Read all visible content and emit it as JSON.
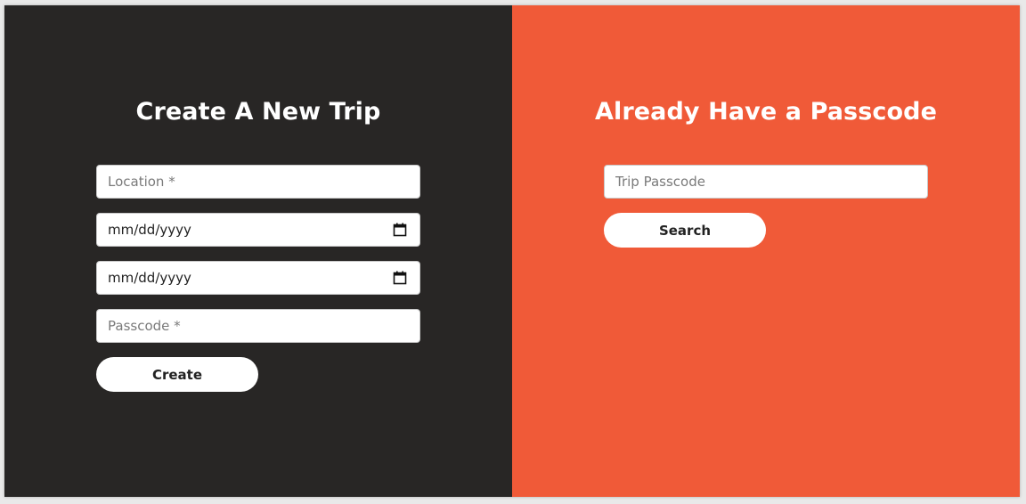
{
  "create_panel": {
    "title": "Create A New Trip",
    "location_placeholder": "Location *",
    "start_date_text": "mm/dd/yyyy",
    "end_date_text": "mm/dd/yyyy",
    "passcode_placeholder": "Passcode *",
    "create_label": "Create",
    "background": "#282625"
  },
  "passcode_panel": {
    "title": "Already Have a Passcode",
    "trip_passcode_placeholder": "Trip Passcode",
    "search_label": "Search",
    "background": "#f05a38"
  },
  "icons": {
    "date_picker": "calendar-icon"
  }
}
